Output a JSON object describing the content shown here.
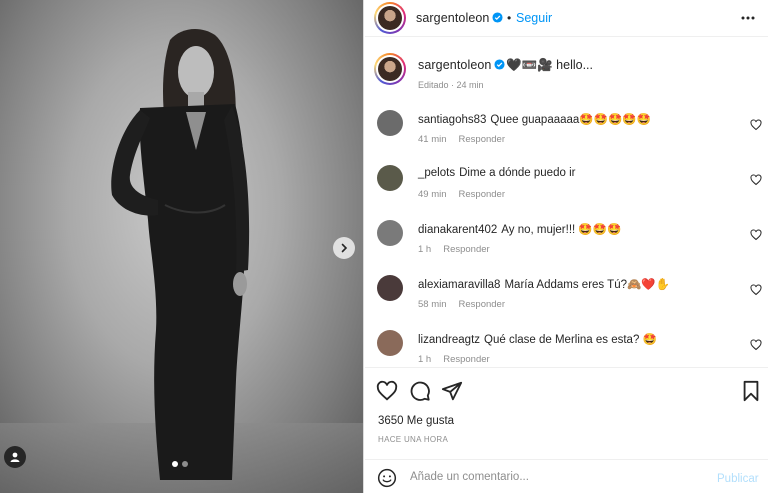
{
  "post": {
    "username": "sargentoleon",
    "separator": "•",
    "follow_label": "Seguir",
    "caption_text": "🖤📼🎥 hello...",
    "caption_meta": "Editado · 24 min",
    "likes": "3650 Me gusta",
    "time": "HACE UNA HORA"
  },
  "comments": [
    {
      "user": "santiagohs83",
      "text": "Quee guapaaaaa🤩🤩🤩🤩🤩",
      "time": "41 min",
      "reply": "Responder",
      "avatar_color": "#6b6b6b"
    },
    {
      "user": "_pelots",
      "text": "Dime a dónde puedo ir",
      "time": "49 min",
      "reply": "Responder",
      "avatar_color": "#5a5a4a"
    },
    {
      "user": "dianakarent402",
      "text": "Ay no, mujer!!! 🤩🤩🤩",
      "time": "1 h",
      "reply": "Responder",
      "avatar_color": "#7a7a7a"
    },
    {
      "user": "alexiamaravilla8",
      "text": "María Addams eres Tú?🙈❤️✋",
      "time": "58 min",
      "reply": "Responder",
      "avatar_color": "#4a3a3a"
    },
    {
      "user": "lizandreagtz",
      "text": "Qué clase de Merlina es esta? 🤩",
      "time": "1 h",
      "reply": "Responder",
      "avatar_color": "#8a6a5a"
    }
  ],
  "composer": {
    "placeholder": "Añade un comentario...",
    "publish_label": "Publicar"
  },
  "icons": {
    "more": "more-horizontal-icon",
    "verified": "verified-badge-icon",
    "like": "heart-icon",
    "comment": "comment-icon",
    "share": "send-icon",
    "save": "bookmark-icon",
    "emoji": "emoji-icon",
    "next": "chevron-right-icon",
    "tag": "user-tag-icon"
  },
  "colors": {
    "accent": "#0095f6",
    "publish_disabled": "#b2dffc",
    "muted": "#8e8e8e"
  },
  "carousel": {
    "slide_count": 2,
    "active_slide": 1
  }
}
